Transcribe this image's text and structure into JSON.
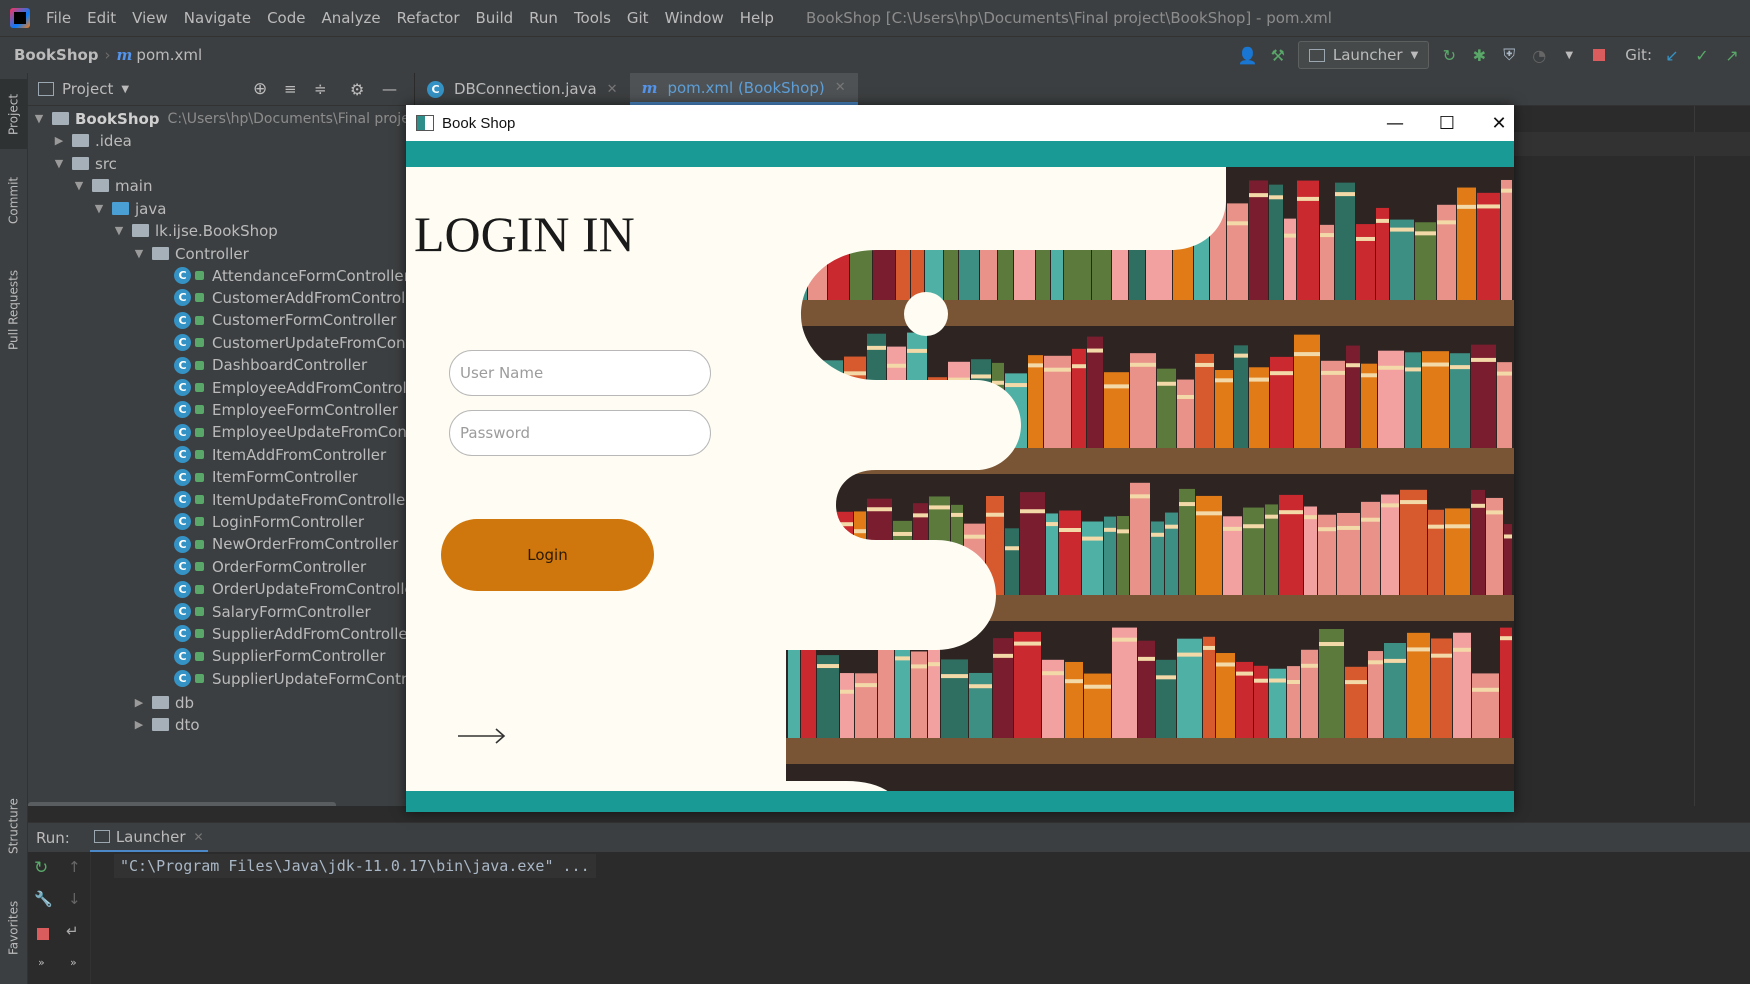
{
  "ide": {
    "menu": [
      "File",
      "Edit",
      "View",
      "Navigate",
      "Code",
      "Analyze",
      "Refactor",
      "Build",
      "Run",
      "Tools",
      "Git",
      "Window",
      "Help"
    ],
    "window_title": "BookShop [C:\\Users\\hp\\Documents\\Final project\\BookShop] - pom.xml",
    "breadcrumb": {
      "root": "BookShop",
      "file": "pom.xml"
    },
    "run_config": "Launcher",
    "git_label": "Git:",
    "side_tabs": {
      "project": "Project",
      "commit": "Commit",
      "pull_requests": "Pull Requests",
      "structure": "Structure",
      "favorites": "Favorites"
    },
    "project_panel": {
      "title": "Project"
    },
    "tree": {
      "root": {
        "label": "BookShop",
        "path": "C:\\Users\\hp\\Documents\\Final project"
      },
      "idea": ".idea",
      "src": "src",
      "main": "main",
      "java": "java",
      "package": "lk.ijse.BookShop",
      "controller_folder": "Controller",
      "controllers": [
        "AttendanceFormController",
        "CustomerAddFromController",
        "CustomerFormController",
        "CustomerUpdateFromController",
        "DashboardController",
        "EmployeeAddFromController",
        "EmployeeFormController",
        "EmployeeUpdateFromController",
        "ItemAddFromController",
        "ItemFormController",
        "ItemUpdateFromController",
        "LoginFormController",
        "NewOrderFromController",
        "OrderFormController",
        "OrderUpdateFromController",
        "SalaryFormController",
        "SupplierAddFromController",
        "SupplierFormController",
        "SupplierUpdateFormController"
      ],
      "db": "db",
      "dto": "dto"
    },
    "editor_tabs": [
      {
        "label": "DBConnection.java",
        "active": false
      },
      {
        "label": "pom.xml (BookShop)",
        "active": true
      }
    ],
    "run_panel": {
      "label": "Run:",
      "tab": "Launcher",
      "command": "\"C:\\Program Files\\Java\\jdk-11.0.17\\bin\\java.exe\" ..."
    }
  },
  "app": {
    "title": "Book Shop",
    "heading": "LOGIN IN",
    "username_placeholder": "User Name",
    "password_placeholder": "Password",
    "login_button": "Login",
    "colors": {
      "teal": "#1a9a94",
      "button": "#cf770c",
      "cream": "#fffdf3",
      "shelf_bg": "#2e2523",
      "wood": "#7a5535"
    }
  }
}
